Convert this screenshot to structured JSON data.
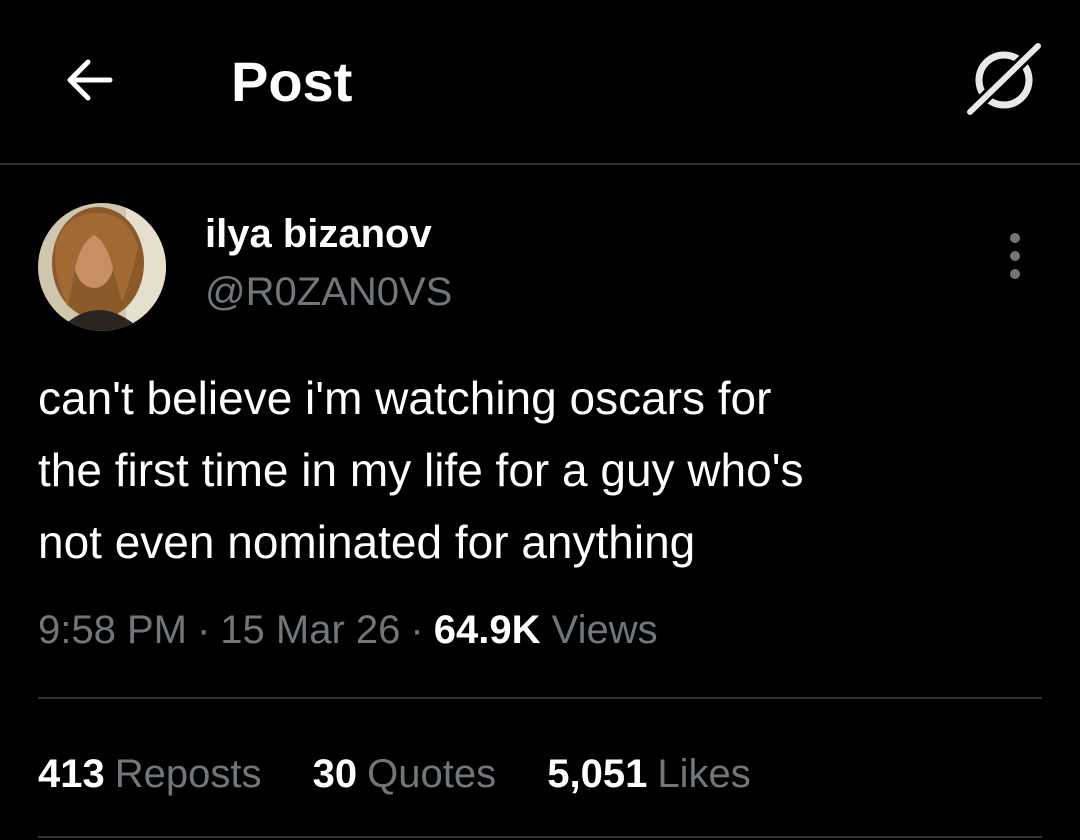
{
  "header": {
    "title": "Post",
    "back_icon": "arrow-left-icon",
    "grok_icon": "grok-icon"
  },
  "author": {
    "display_name": "ilya bizanov",
    "handle": "@R0ZAN0VS",
    "avatar_icon": "avatar"
  },
  "post": {
    "text": "can't believe i'm watching oscars for\nthe first time in my life for a guy who's\nnot even nominated for anything",
    "time": "9:58 PM",
    "date": "15 Mar 26",
    "views_count": "64.9K",
    "views_label": "Views",
    "separator": "·"
  },
  "stats": {
    "reposts": {
      "count": "413",
      "label": "Reposts"
    },
    "quotes": {
      "count": "30",
      "label": "Quotes"
    },
    "likes": {
      "count": "5,051",
      "label": "Likes"
    }
  },
  "colors": {
    "background": "#000000",
    "text_primary": "#ffffff",
    "text_secondary": "#71767b",
    "divider": "#2f3336"
  }
}
